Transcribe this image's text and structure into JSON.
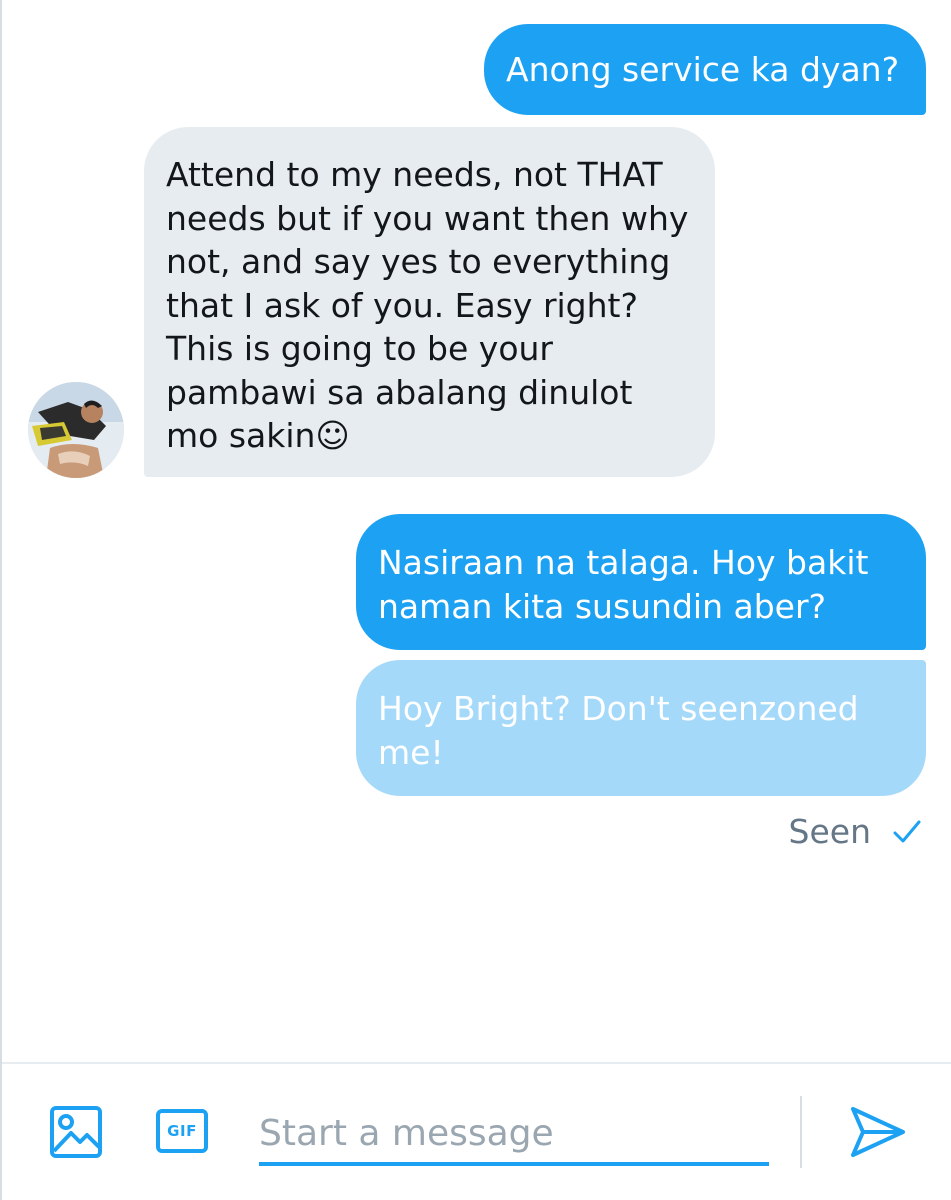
{
  "messages": [
    {
      "direction": "outgoing",
      "status": "sent",
      "lines": [
        "Anong service ka dyan?"
      ]
    },
    {
      "direction": "incoming",
      "lines": [
        "Attend to my needs, not THAT",
        "needs but if you want then why",
        "not, and say yes to everything",
        "that I ask of you. Easy right?",
        "This is going to be your",
        "pambawi sa abalang dinulot",
        "mo sakin☺"
      ]
    },
    {
      "direction": "outgoing",
      "status": "sent",
      "lines": [
        "Nasiraan na talaga. Hoy bakit",
        "naman kita susundin aber?"
      ]
    },
    {
      "direction": "outgoing",
      "status": "pending",
      "lines": [
        "Hoy Bright? Don't seenzoned",
        "me!"
      ]
    }
  ],
  "read_receipt": {
    "label": "Seen",
    "icon": "checkmark-icon"
  },
  "composer": {
    "placeholder": "Start a message",
    "media_icon": "image-icon",
    "gif_label": "GIF",
    "send_icon": "send-icon"
  },
  "colors": {
    "accent": "#1da1f2",
    "outgoing_pending": "#a5d9fa",
    "incoming_bubble": "#e6ecf0",
    "muted_text": "#657786"
  }
}
